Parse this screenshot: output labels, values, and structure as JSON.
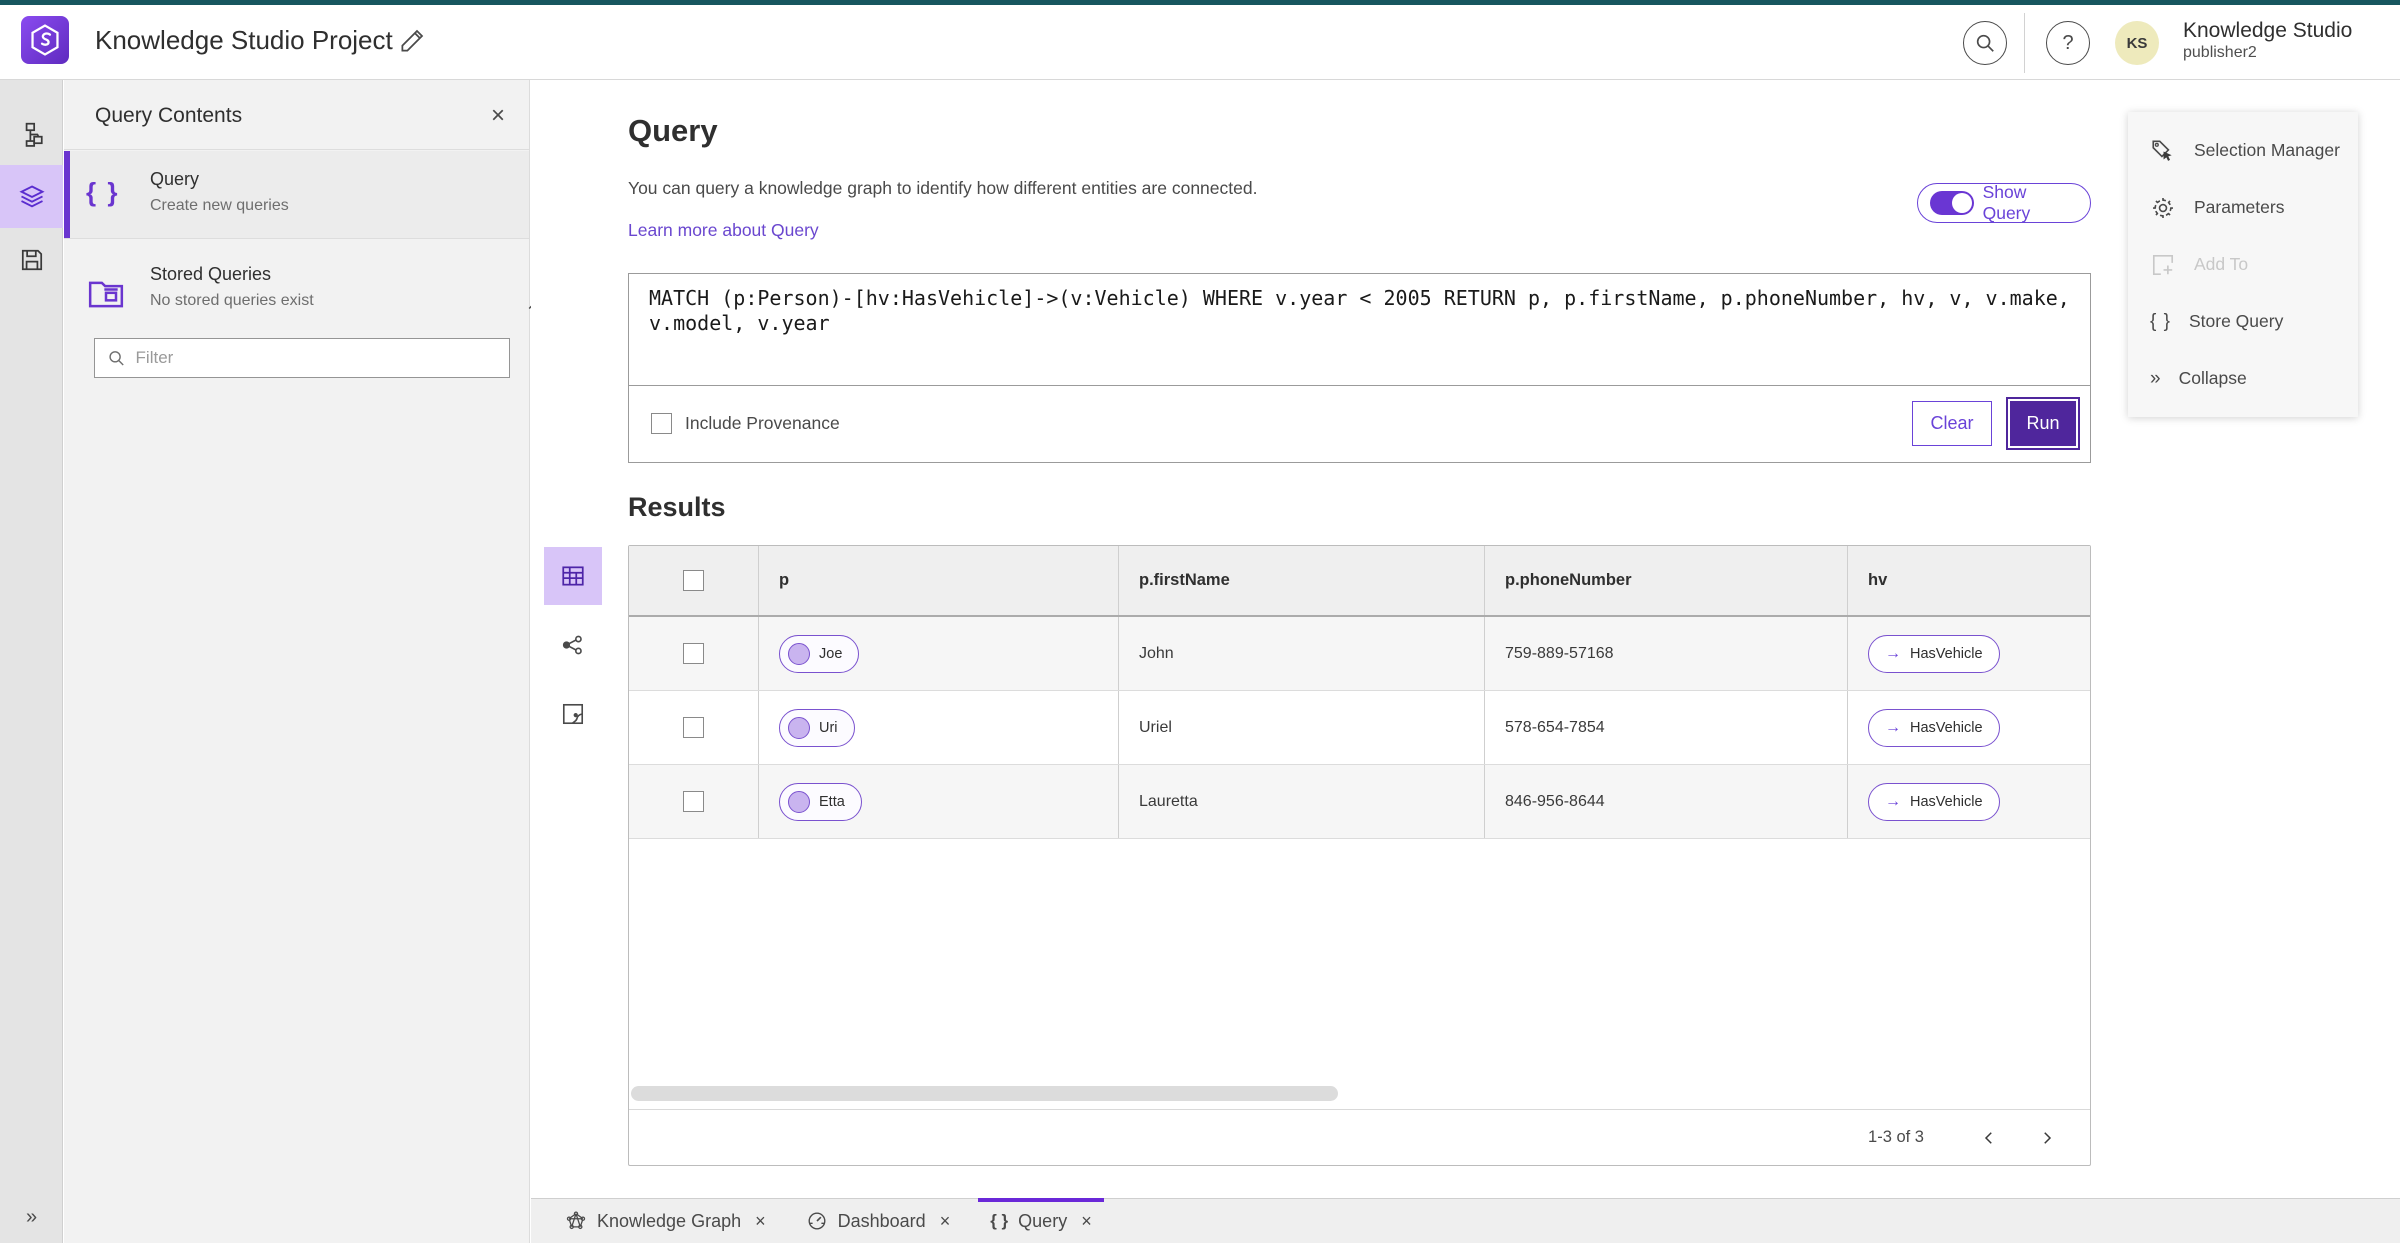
{
  "header": {
    "title": "Knowledge Studio Project",
    "app_name": "Knowledge Studio",
    "user_name": "publisher2",
    "avatar_initials": "KS",
    "help_glyph": "?"
  },
  "panel": {
    "title": "Query Contents",
    "close_glyph": "×",
    "query_item": {
      "label": "Query",
      "sublabel": "Create new queries"
    },
    "stored": {
      "label": "Stored Queries",
      "sublabel": "No stored queries exist"
    },
    "filter_placeholder": "Filter"
  },
  "main": {
    "title": "Query",
    "description": "You can query a knowledge graph to identify how different entities are connected.",
    "learn_link": "Learn more about Query",
    "toggle_label": "Show Query",
    "query_text": "MATCH (p:Person)-[hv:HasVehicle]->(v:Vehicle) WHERE v.year < 2005 RETURN p, p.firstName, p.phoneNumber, hv, v, v.make, v.model, v.year",
    "include_provenance_label": "Include Provenance",
    "clear_label": "Clear",
    "run_label": "Run",
    "results_title": "Results"
  },
  "table": {
    "columns": [
      "p",
      "p.firstName",
      "p.phoneNumber",
      "hv"
    ],
    "rows": [
      {
        "p": "Joe",
        "firstName": "John",
        "phone": "759-889-57168",
        "hv": "HasVehicle"
      },
      {
        "p": "Uri",
        "firstName": "Uriel",
        "phone": "578-654-7854",
        "hv": "HasVehicle"
      },
      {
        "p": "Etta",
        "firstName": "Lauretta",
        "phone": "846-956-8644",
        "hv": "HasVehicle"
      }
    ],
    "rel_arrow": "→",
    "pagination": "1-3 of 3"
  },
  "right_menu": {
    "items": [
      {
        "label": "Selection Manager"
      },
      {
        "label": "Parameters"
      },
      {
        "label": "Add To"
      },
      {
        "label": "Store Query"
      },
      {
        "label": "Collapse"
      }
    ],
    "collapse_glyph": "»"
  },
  "tabs": [
    {
      "label": "Knowledge Graph"
    },
    {
      "label": "Dashboard"
    },
    {
      "label": "Query"
    }
  ],
  "misc": {
    "rail_expand_glyph": "»",
    "braces_glyph": "{ }"
  },
  "colors": {
    "accent": "#6a35cf",
    "run_fill": "#4f269c",
    "top_strip": "#17565f",
    "selected_bg": "#d8c5f8"
  }
}
